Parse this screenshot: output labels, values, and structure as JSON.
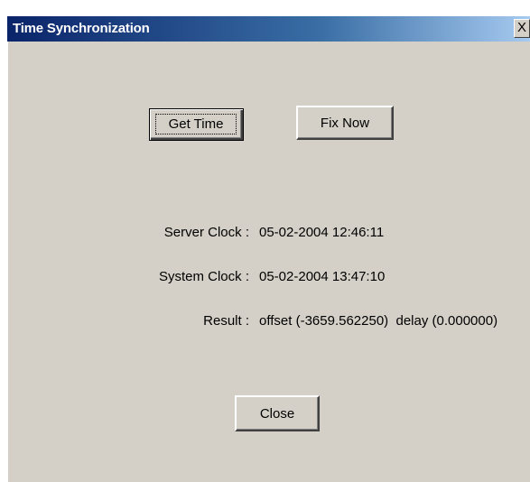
{
  "window": {
    "title": "Time Synchronization",
    "close_glyph": "X"
  },
  "buttons": {
    "get_time": "Get Time",
    "fix_now": "Fix Now",
    "close": "Close"
  },
  "fields": {
    "server_clock_label": "Server Clock :",
    "server_clock_value": "05-02-2004 12:46:11",
    "system_clock_label": "System Clock :",
    "system_clock_value": "05-02-2004 13:47:10",
    "result_label": "Result :",
    "result_value": "offset (-3659.562250)  delay (0.000000)"
  },
  "colors": {
    "dialog_face": "#d4d0c8",
    "titlebar_start": "#0a246a",
    "titlebar_end": "#a6caf0"
  }
}
